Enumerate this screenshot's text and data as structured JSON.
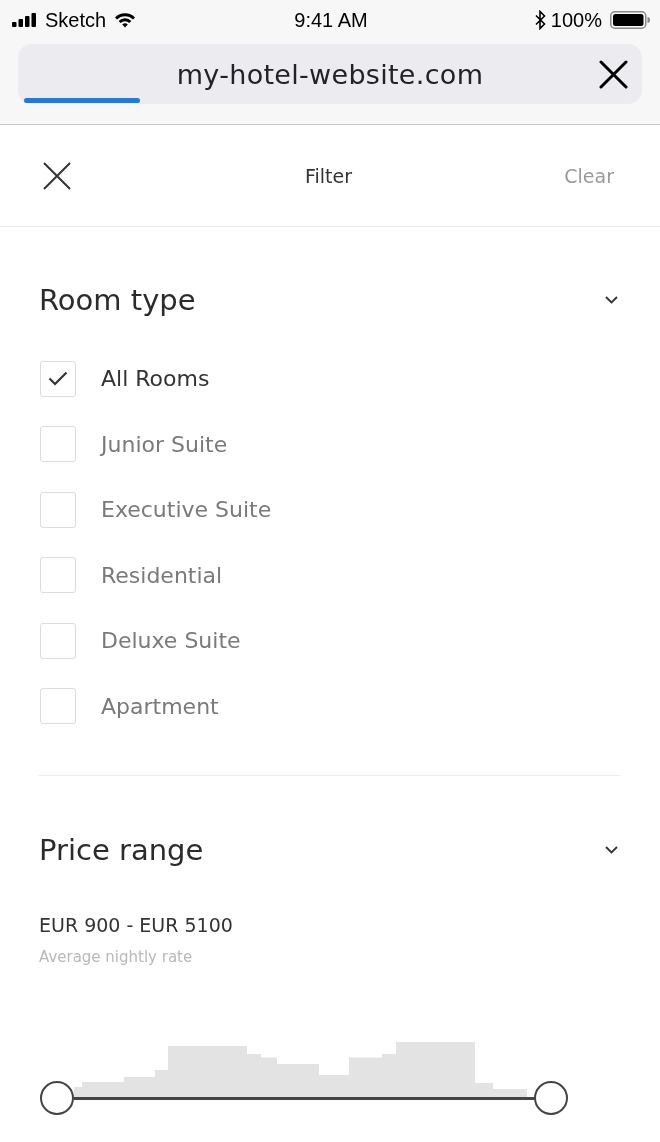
{
  "status_bar": {
    "carrier": "Sketch",
    "time": "9:41 AM",
    "battery": "100%"
  },
  "address_bar": {
    "url": "my-hotel-website.com",
    "progress": {
      "level": 0.19
    }
  },
  "header": {
    "title": "Filter",
    "clear": "Clear"
  },
  "sections": [
    {
      "kind": "checkbox_list",
      "title": "Room type",
      "options": [
        {
          "label": "All Rooms",
          "checked": true
        },
        {
          "label": "Junior Suite",
          "checked": false
        },
        {
          "label": "Executive Suite",
          "checked": false
        },
        {
          "label": "Residential",
          "checked": false
        },
        {
          "label": "Deluxe Suite",
          "checked": false
        },
        {
          "label": "Apartment",
          "checked": false
        }
      ]
    },
    {
      "kind": "price_range",
      "title": "Price range",
      "range": "EUR 900 - EUR 5100",
      "caption": "Average nightly rate",
      "slider": {
        "thumbs": [
          {
            "level": 0
          },
          {
            "level": 1
          }
        ]
      }
    }
  ]
}
